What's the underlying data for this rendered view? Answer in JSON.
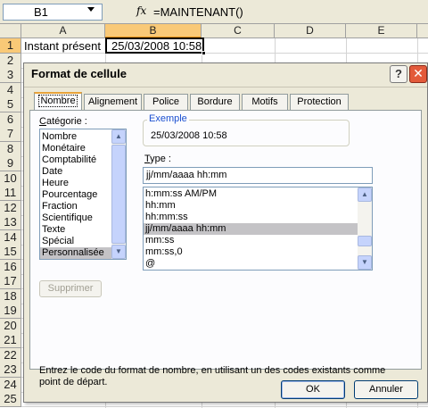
{
  "formula_bar": {
    "name_box": "B1",
    "fx_label": "fx",
    "formula": "=MAINTENANT()"
  },
  "sheet": {
    "columns": [
      "A",
      "B",
      "C",
      "D",
      "E"
    ],
    "rows": [
      "1",
      "2",
      "3",
      "4",
      "5",
      "6",
      "7",
      "8",
      "9",
      "10",
      "11",
      "12",
      "13",
      "14",
      "15",
      "16",
      "17",
      "18",
      "19",
      "20",
      "21",
      "22",
      "23",
      "24",
      "25"
    ],
    "a1_value": "Instant présent",
    "b1_value": "25/03/2008 10:58"
  },
  "dialog": {
    "title": "Format de cellule",
    "help_label": "?",
    "close_label": "✕",
    "tabs": [
      {
        "label": "Nombre",
        "active": true
      },
      {
        "label": "Alignement",
        "active": false
      },
      {
        "label": "Police",
        "active": false
      },
      {
        "label": "Bordure",
        "active": false
      },
      {
        "label": "Motifs",
        "active": false
      },
      {
        "label": "Protection",
        "active": false
      }
    ],
    "category_label_u": "C",
    "category_label_rest": "atégorie :",
    "categories": [
      "Nombre",
      "Monétaire",
      "Comptabilité",
      "Date",
      "Heure",
      "Pourcentage",
      "Fraction",
      "Scientifique",
      "Texte",
      "Spécial",
      "Personnalisée"
    ],
    "selected_category": "Personnalisée",
    "example_label": "Exemple",
    "example_value": "25/03/2008 10:58",
    "type_label_u": "T",
    "type_label_rest": "ype :",
    "type_value": "jj/mm/aaaa hh:mm",
    "type_list": [
      "h:mm:ss AM/PM",
      "hh:mm",
      "hh:mm:ss",
      "jj/mm/aaaa hh:mm",
      "mm:ss",
      "mm:ss,0",
      "@"
    ],
    "selected_type": "jj/mm/aaaa hh:mm",
    "delete_button": "Supprimer",
    "hint": "Entrez le code du format de nombre, en utilisant un des codes existants comme point de départ.",
    "ok_button": "OK",
    "cancel_button": "Annuler"
  },
  "colors": {
    "selected_header": "#f9c977",
    "active_tab_accent": "#e8a33a",
    "close_button": "#e35a3a",
    "group_label": "#1a4fd0"
  }
}
